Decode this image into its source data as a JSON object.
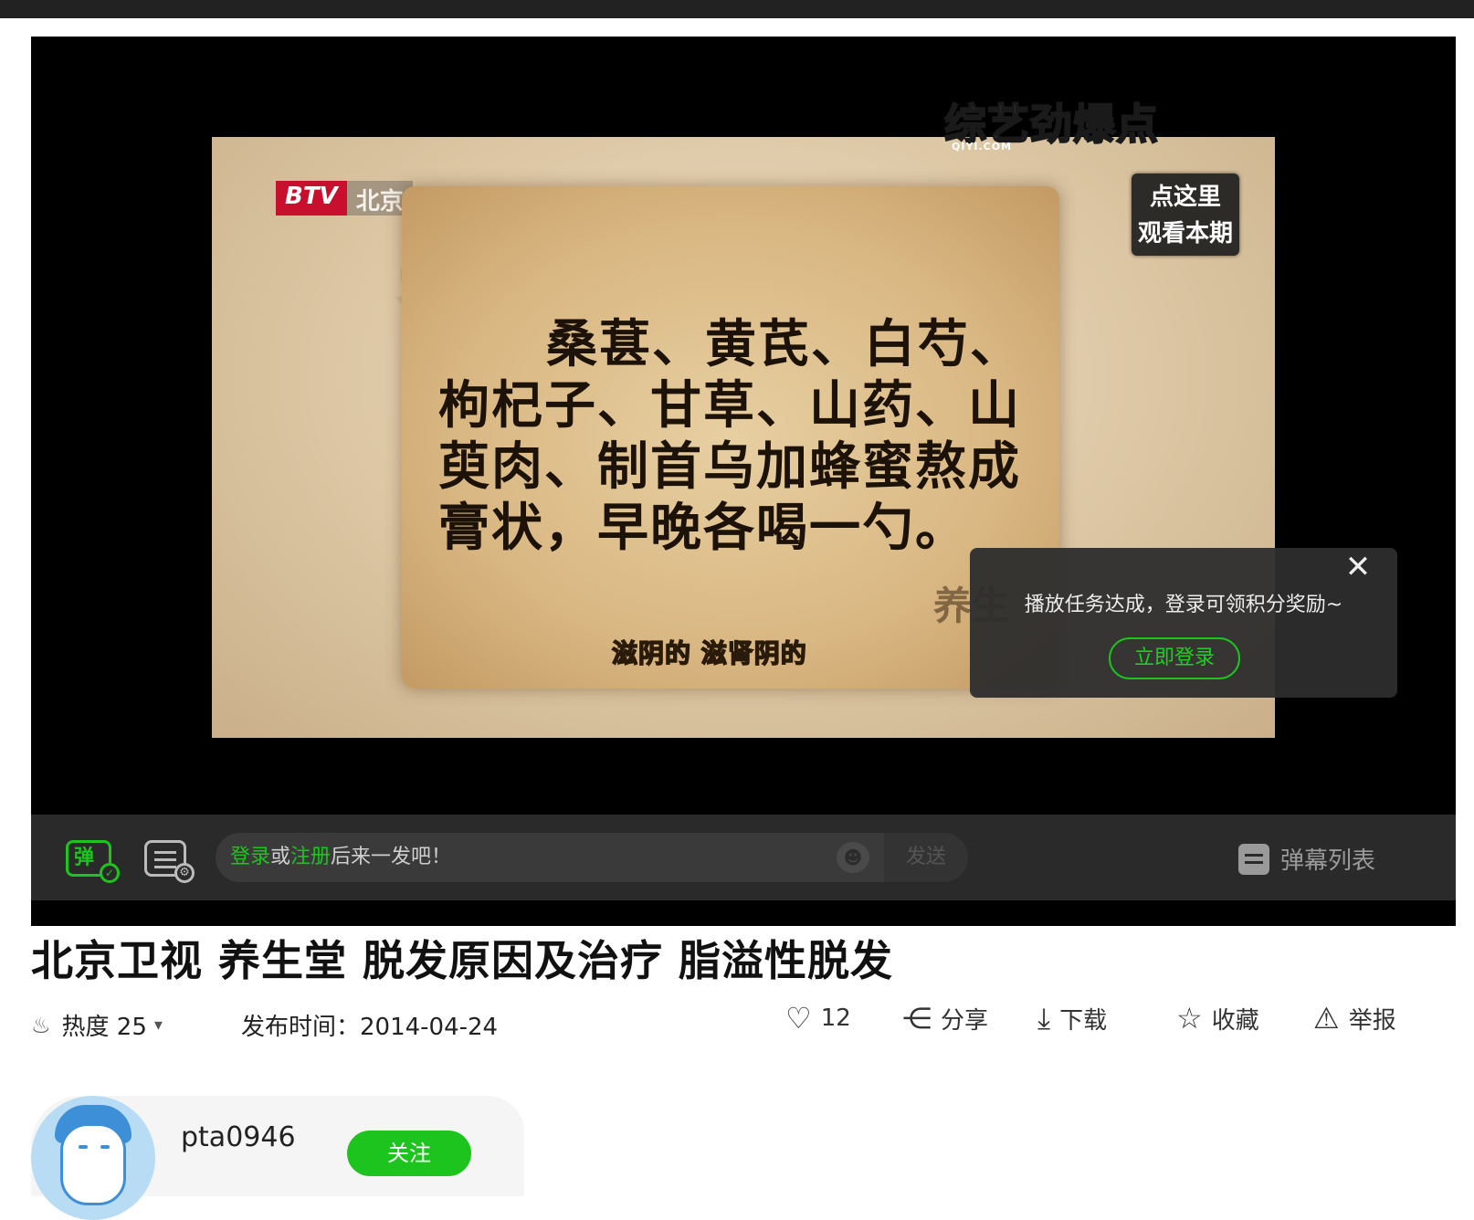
{
  "video": {
    "channel_logo_primary": "BTV",
    "channel_logo_secondary": "北京",
    "scroll_lines": [
      "桑葚、黄芪、白芍、",
      "枸杞子、甘草、山药、山",
      "萸肉、制首乌加蜂蜜熬成",
      "膏状，早晚各喝一勺。"
    ],
    "subtitle": "滋阴的 滋肾阴的",
    "variety_logo": "综艺",
    "variety_logo_accent": "劲爆点",
    "variety_logo_small": "QIYI.COM",
    "watch_badge_line1": "点这里",
    "watch_badge_line2": "观看本期",
    "stamp_text": "养生"
  },
  "login_popup": {
    "message": "播放任务达成，登录可领积分奖励~",
    "button_label": "立即登录",
    "close_glyph": "✕"
  },
  "danmu": {
    "toggle_label": "弹",
    "input_login": "登录",
    "input_or": "或",
    "input_register": "注册",
    "input_rest": "后来一发吧！",
    "send_label": "发送",
    "list_label": "弹幕列表"
  },
  "title": "北京卫视 养生堂 脱发原因及治疗 脂溢性脱发",
  "meta": {
    "heat_label": "热度 25",
    "publish_time": "发布时间：2014-04-24",
    "like_count": "12",
    "share_label": "分享",
    "download_label": "下载",
    "favorite_label": "收藏",
    "report_label": "举报"
  },
  "user": {
    "name": "pta0946",
    "follow_label": "关注"
  },
  "colors": {
    "accent_green": "#1dc41d",
    "player_bg": "#000000",
    "danmu_bar_bg": "#2a2a2a"
  }
}
